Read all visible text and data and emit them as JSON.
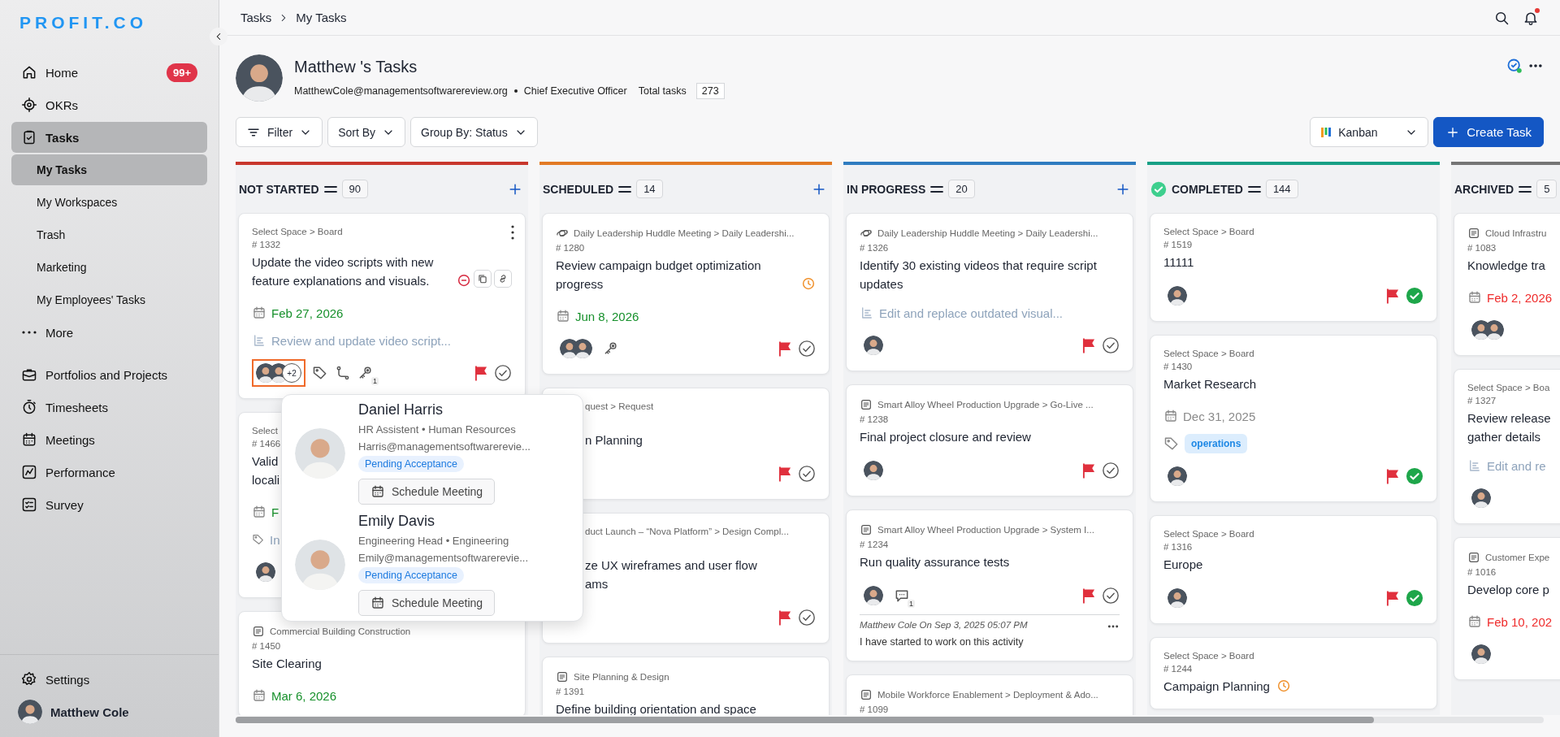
{
  "logo": "PROFIT.CO",
  "nav": [
    {
      "label": "Home",
      "badge": "99+",
      "selected": false
    },
    {
      "label": "OKRs",
      "selected": false
    },
    {
      "label": "Tasks",
      "selected": true,
      "children": [
        {
          "label": "My Tasks",
          "selected": true
        },
        {
          "label": "My Workspaces",
          "selected": false
        },
        {
          "label": "Trash",
          "selected": false
        },
        {
          "label": "Marketing",
          "selected": false
        },
        {
          "label": "My Employees' Tasks",
          "selected": false
        }
      ]
    },
    {
      "label": "More",
      "selected": false
    }
  ],
  "apps": [
    {
      "label": "Portfolios and Projects",
      "selected": false
    },
    {
      "label": "Timesheets",
      "selected": false
    },
    {
      "label": "Meetings",
      "selected": false
    },
    {
      "label": "Performance",
      "selected": false
    },
    {
      "label": "Survey",
      "selected": false
    }
  ],
  "settings": "Settings",
  "user": "Matthew Cole",
  "breadcrumb": [
    "Tasks",
    "My Tasks"
  ],
  "notifications": {
    "unread": true
  },
  "header": {
    "title": "Matthew 's Tasks",
    "email": "MatthewCole@managementsoftwarereview.org",
    "role": "Chief Executive Officer",
    "total_label": "Total tasks",
    "total": "273"
  },
  "toolbar": {
    "buttons": [
      "Filter",
      "Sort By",
      "Group By: Status"
    ],
    "view": "Kanban",
    "create": "Create Task"
  },
  "columns": [
    {
      "title": "NOT STARTED",
      "count": "90",
      "color": "#c8372d",
      "kind": "open",
      "can_add": true,
      "cards": [
        {
          "kind": "plain",
          "path": "Select Space > Board",
          "menu": true,
          "number": "# 1332",
          "title": "Update the video scripts with new feature explanations and visuals.",
          "indicators": [
            {
              "kind": "blocked"
            },
            {
              "kind": "copy"
            },
            {
              "kind": "link"
            }
          ],
          "date": {
            "text": "Feb 27, 2026",
            "kind": "upcoming"
          },
          "subtask": {
            "kind": "subtask",
            "text": "Review and update video script..."
          },
          "assignees": [
            {
              "kind": "person"
            },
            {
              "kind": "person"
            }
          ],
          "extra": {
            "label": "+2",
            "selected": true
          },
          "tools": [
            {
              "kind": "tag"
            },
            {
              "kind": "branch"
            },
            {
              "kind": "key",
              "count": "1"
            }
          ],
          "flagged": true,
          "done": false
        },
        {
          "kind": "plain",
          "path": "Select",
          "number": "# 1466",
          "title": "Valid\nlocali",
          "date": {
            "text": "F",
            "kind": "upcoming"
          },
          "subtask": {
            "kind": "tag",
            "text": "In"
          },
          "assignees": [
            {
              "kind": "person"
            }
          ]
        },
        {
          "kind": "document",
          "path": "Commercial Building Construction",
          "number": "# 1450",
          "title": "Site Clearing",
          "date": {
            "text": "Mar 6, 2026",
            "kind": "upcoming"
          }
        }
      ]
    },
    {
      "title": "SCHEDULED",
      "count": "14",
      "color": "#e27a24",
      "kind": "open",
      "can_add": true,
      "cards": [
        {
          "kind": "meeting",
          "path": "Daily Leadership Huddle Meeting > Daily Leadershi...",
          "number": "# 1280",
          "title": "Review campaign budget optimization progress",
          "indicators": [
            {
              "kind": "clock"
            }
          ],
          "date": {
            "text": "Jun 8, 2026",
            "kind": "upcoming"
          },
          "assignees": [
            {
              "kind": "person"
            },
            {
              "kind": "person"
            }
          ],
          "tools": [
            {
              "kind": "key"
            }
          ],
          "flagged": true,
          "done": false
        },
        {
          "kind": "plain",
          "path": "quest > Request",
          "title": "n Planning",
          "flagged": true,
          "done": false
        },
        {
          "kind": "plain",
          "path": "duct Launch – “Nova Platform” > Design Compl...",
          "title": "ze UX wireframes and user flow\nams",
          "flagged": true,
          "done": false
        },
        {
          "kind": "document",
          "path": "Site Planning & Design",
          "number": "# 1391",
          "title": "Define building orientation and space"
        }
      ]
    },
    {
      "title": "IN PROGRESS",
      "count": "20",
      "color": "#2f7cc0",
      "kind": "open",
      "can_add": true,
      "cards": [
        {
          "kind": "meeting",
          "path": "Daily Leadership Huddle Meeting > Daily Leadershi...",
          "number": "# 1326",
          "title": "Identify 30 existing videos that require script updates",
          "subtask": {
            "kind": "subtask",
            "text": "Edit and replace outdated visual..."
          },
          "assignees": [
            {
              "kind": "person"
            }
          ],
          "flagged": true,
          "done": false
        },
        {
          "kind": "document",
          "path": "Smart Alloy Wheel Production Upgrade > Go-Live ...",
          "number": "# 1238",
          "title": "Final project closure and review",
          "assignees": [
            {
              "kind": "person"
            }
          ],
          "flagged": true,
          "done": false
        },
        {
          "kind": "document",
          "path": "Smart Alloy Wheel Production Upgrade > System I...",
          "number": "# 1234",
          "title": "Run quality assurance tests",
          "assignees": [
            {
              "kind": "person"
            }
          ],
          "tools": [
            {
              "kind": "comment",
              "count": "1"
            }
          ],
          "flagged": true,
          "done": false,
          "comment": {
            "meta": "Matthew Cole On Sep 3, 2025 05:07 PM",
            "text": "I have started to work on this activity"
          }
        },
        {
          "kind": "document",
          "path": "Mobile Workforce Enablement > Deployment & Ado...",
          "number": "# 1099"
        }
      ]
    },
    {
      "title": "COMPLETED",
      "count": "144",
      "color": "#17a085",
      "kind": "completed",
      "can_add": false,
      "cards": [
        {
          "kind": "plain",
          "path": "Select Space > Board",
          "number": "# 1519",
          "title": "11111",
          "assignees": [
            {
              "kind": "person"
            }
          ],
          "flagged": true,
          "done": true
        },
        {
          "kind": "plain",
          "path": "Select Space > Board",
          "number": "# 1430",
          "title": "Market Research",
          "date": {
            "text": "Dec 31, 2025",
            "kind": "neutral"
          },
          "tags": [
            "operations"
          ],
          "assignees": [
            {
              "kind": "person"
            }
          ],
          "flagged": true,
          "done": true
        },
        {
          "kind": "plain",
          "path": "Select Space > Board",
          "number": "# 1316",
          "title": "Europe",
          "assignees": [
            {
              "kind": "person"
            }
          ],
          "flagged": true,
          "done": true
        },
        {
          "kind": "plain",
          "path": "Select Space > Board",
          "number": "# 1244",
          "title": "Campaign Planning",
          "indicators": [
            {
              "kind": "clock"
            }
          ]
        }
      ]
    },
    {
      "title": "ARCHIVED",
      "count": "5",
      "color": "#757575",
      "kind": "open",
      "can_add": false,
      "cards": [
        {
          "kind": "document",
          "path": "Cloud Infrastru",
          "number": "# 1083",
          "title": "Knowledge tra",
          "date": {
            "text": "Feb 2, 2026",
            "kind": "overdue"
          },
          "assignees": [
            {
              "kind": "person"
            },
            {
              "kind": "person"
            }
          ]
        },
        {
          "kind": "plain",
          "path": "Select Space > Boa",
          "number": "# 1327",
          "title": "Review release\ngather details",
          "subtask": {
            "kind": "subtask",
            "text": "Edit and re"
          },
          "assignees": [
            {
              "kind": "person"
            }
          ]
        },
        {
          "kind": "document",
          "path": "Customer Expe",
          "number": "# 1016",
          "title": "Develop core p",
          "date": {
            "text": "Feb 10, 202",
            "kind": "overdue"
          },
          "assignees": [
            {
              "kind": "person"
            }
          ]
        }
      ]
    }
  ],
  "assignee_popup": {
    "people": [
      {
        "name": "Daniel Harris",
        "role": "HR Assistent • Human Resources",
        "email": "Harris@managementsoftwarerevie...",
        "status": "Pending Acceptance",
        "action": "Schedule Meeting"
      },
      {
        "name": "Emily Davis",
        "role": "Engineering Head • Engineering",
        "email": "Emily@managementsoftwarerevie...",
        "status": "Pending Acceptance",
        "action": "Schedule Meeting"
      }
    ]
  }
}
